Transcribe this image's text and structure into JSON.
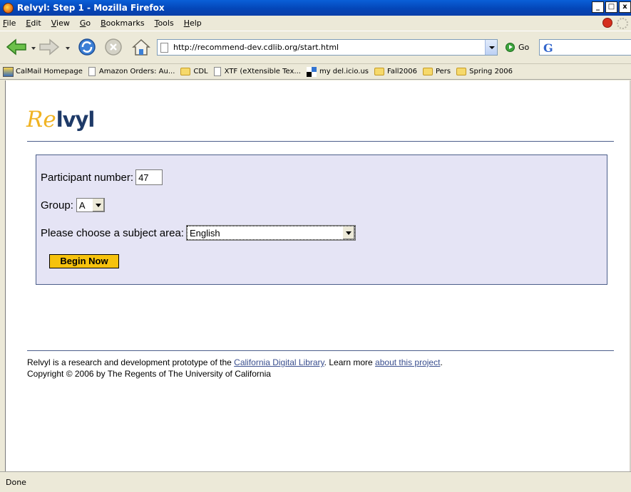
{
  "window": {
    "title": "Relvyl: Step 1 - Mozilla Firefox",
    "minimize": "_",
    "maximize": "□",
    "close": "x"
  },
  "menu": [
    "File",
    "Edit",
    "View",
    "Go",
    "Bookmarks",
    "Tools",
    "Help"
  ],
  "navbar": {
    "url": "http://recommend-dev.cdlib.org/start.html",
    "go_label": "Go",
    "search_logo": "G"
  },
  "bookmarks": [
    {
      "label": "CalMail Homepage",
      "icon": "mail-icon"
    },
    {
      "label": "Amazon Orders: Au...",
      "icon": "page-icon"
    },
    {
      "label": "CDL",
      "icon": "folder-icon"
    },
    {
      "label": "XTF (eXtensible Tex...",
      "icon": "page-icon"
    },
    {
      "label": "my del.icio.us",
      "icon": "delicious-icon"
    },
    {
      "label": "Fall2006",
      "icon": "folder-icon"
    },
    {
      "label": "Pers",
      "icon": "folder-icon"
    },
    {
      "label": "Spring 2006",
      "icon": "folder-icon"
    }
  ],
  "logo": {
    "part1": "Re",
    "part2": "lvyl"
  },
  "form": {
    "participant_label": "Participant number:",
    "participant_value": "47",
    "group_label": "Group:",
    "group_value": "A",
    "subject_label": "Please choose a subject area:",
    "subject_value": "English",
    "begin_label": "Begin Now"
  },
  "footer": {
    "line1_text": "Relvyl is a research and development prototype of the ",
    "cdl_link": "California Digital Library",
    "learn_more": ". Learn more ",
    "about_link": "about this project",
    "period": ".",
    "copyright": "Copyright © 2006 by The Regents of The University of California"
  },
  "status": "Done",
  "colors": {
    "logo_accent": "#f0b323",
    "logo_dark": "#1e3a68",
    "form_bg": "#e5e4f5",
    "button_bg": "#f6c20d",
    "link": "#3a4f8f"
  }
}
